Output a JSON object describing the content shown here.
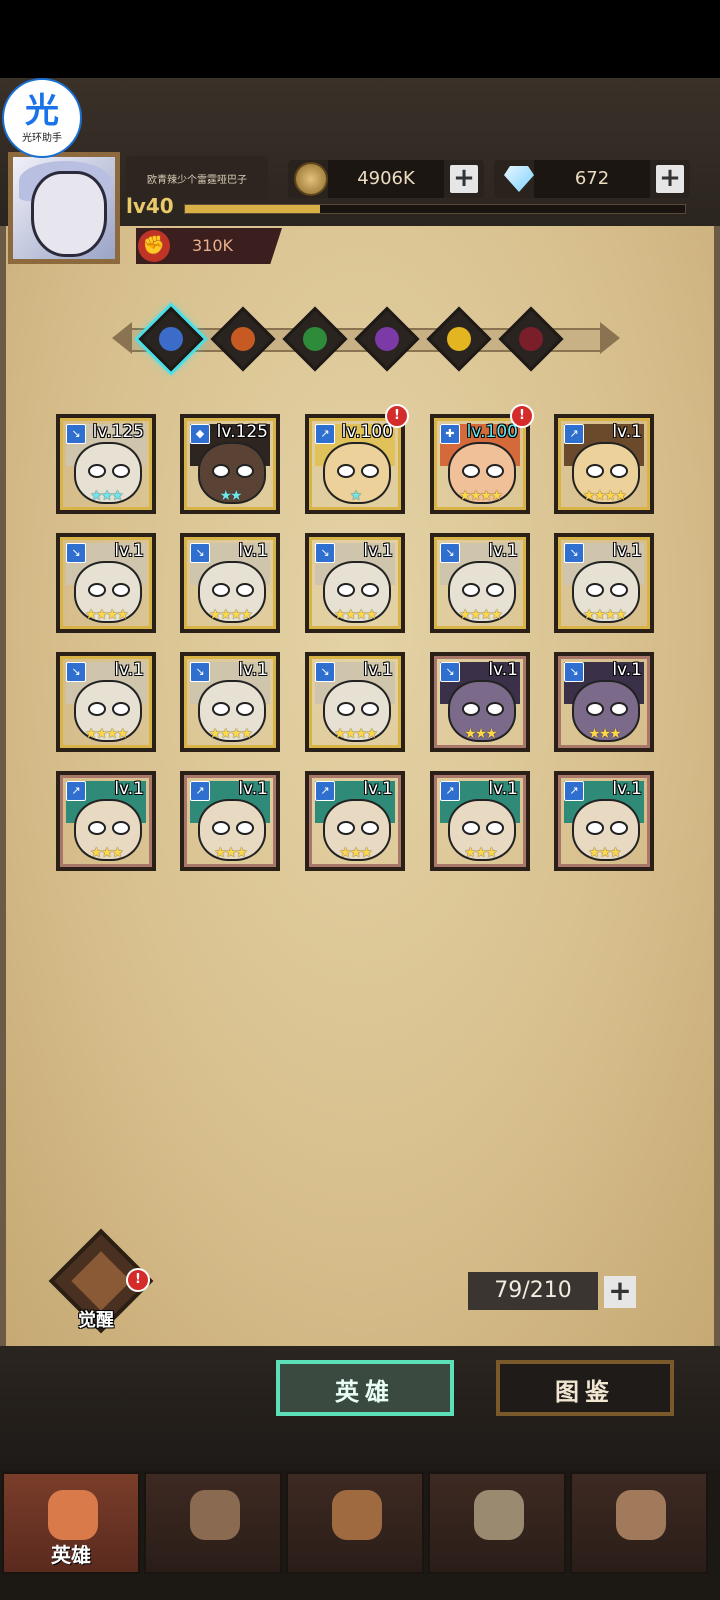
{
  "assistant_badge": {
    "glyph": "光",
    "label": "光环助手"
  },
  "player": {
    "name": "欧青辣少个雷霆哑巴子",
    "level": "lv40",
    "xp_fraction": 0.27,
    "power": "310K"
  },
  "resources": {
    "gold": "4906K",
    "gems": "672",
    "plus": "+"
  },
  "filters": [
    {
      "name": "all",
      "color": "#3b6cc9",
      "selected": true
    },
    {
      "name": "fire",
      "color": "#c75a22",
      "selected": false
    },
    {
      "name": "nature",
      "color": "#2e8b3a",
      "selected": false
    },
    {
      "name": "arcane",
      "color": "#7b3aa6",
      "selected": false
    },
    {
      "name": "light",
      "color": "#e3b521",
      "selected": false
    },
    {
      "name": "dark",
      "color": "#7a1e2a",
      "selected": false
    }
  ],
  "heroes": [
    {
      "lv": "lv.125",
      "stars": "★★★",
      "star_color": "#6ee6ea",
      "frame": "#d8b447",
      "skin": "#e6e1d2",
      "hair": "#cfc4ac",
      "cls": "↘",
      "alert": false,
      "lv_cyan": false
    },
    {
      "lv": "lv.125",
      "stars": "★★",
      "star_color": "#6ee6ea",
      "frame": "#d8b447",
      "skin": "#5a4334",
      "hair": "#2e2520",
      "cls": "◆",
      "alert": false,
      "lv_cyan": false
    },
    {
      "lv": "lv.100",
      "stars": "★",
      "star_color": "#6ee6ea",
      "frame": "#d8b447",
      "skin": "#ecd29a",
      "hair": "#e1c25a",
      "cls": "↗",
      "alert": true,
      "lv_cyan": false
    },
    {
      "lv": "lv.100",
      "stars": "★★★★",
      "star_color": "#ffd84a",
      "frame": "#d8b447",
      "skin": "#f0c098",
      "hair": "#d46a3a",
      "cls": "✚",
      "alert": true,
      "lv_cyan": true
    },
    {
      "lv": "lv.1",
      "stars": "★★★★",
      "star_color": "#ffd84a",
      "frame": "#d8b447",
      "skin": "#ecd29a",
      "hair": "#6a4a2a",
      "cls": "↗",
      "alert": false,
      "lv_cyan": false
    },
    {
      "lv": "lv.1",
      "stars": "★★★★",
      "star_color": "#ffd84a",
      "frame": "#d8b447",
      "skin": "#e6e1d2",
      "hair": "#cfc4ac",
      "cls": "↘",
      "alert": false,
      "lv_cyan": false
    },
    {
      "lv": "lv.1",
      "stars": "★★★★",
      "star_color": "#ffd84a",
      "frame": "#d8b447",
      "skin": "#e6e1d2",
      "hair": "#cfc4ac",
      "cls": "↘",
      "alert": false,
      "lv_cyan": false
    },
    {
      "lv": "lv.1",
      "stars": "★★★★",
      "star_color": "#ffd84a",
      "frame": "#d8b447",
      "skin": "#e6e1d2",
      "hair": "#cfc4ac",
      "cls": "↘",
      "alert": false,
      "lv_cyan": false
    },
    {
      "lv": "lv.1",
      "stars": "★★★★",
      "star_color": "#ffd84a",
      "frame": "#d8b447",
      "skin": "#e6e1d2",
      "hair": "#cfc4ac",
      "cls": "↘",
      "alert": false,
      "lv_cyan": false
    },
    {
      "lv": "lv.1",
      "stars": "★★★★",
      "star_color": "#ffd84a",
      "frame": "#d8b447",
      "skin": "#e6e1d2",
      "hair": "#cfc4ac",
      "cls": "↘",
      "alert": false,
      "lv_cyan": false
    },
    {
      "lv": "lv.1",
      "stars": "★★★★",
      "star_color": "#ffd84a",
      "frame": "#d8b447",
      "skin": "#e6e1d2",
      "hair": "#cfc4ac",
      "cls": "↘",
      "alert": false,
      "lv_cyan": false
    },
    {
      "lv": "lv.1",
      "stars": "★★★★",
      "star_color": "#ffd84a",
      "frame": "#d8b447",
      "skin": "#e6e1d2",
      "hair": "#cfc4ac",
      "cls": "↘",
      "alert": false,
      "lv_cyan": false
    },
    {
      "lv": "lv.1",
      "stars": "★★★★",
      "star_color": "#ffd84a",
      "frame": "#d8b447",
      "skin": "#e6e1d2",
      "hair": "#cfc4ac",
      "cls": "↘",
      "alert": false,
      "lv_cyan": false
    },
    {
      "lv": "lv.1",
      "stars": "★★★",
      "star_color": "#ffd84a",
      "frame": "#a9776a",
      "skin": "#7b6a8a",
      "hair": "#3a3048",
      "cls": "↘",
      "alert": false,
      "lv_cyan": false
    },
    {
      "lv": "lv.1",
      "stars": "★★★",
      "star_color": "#ffd84a",
      "frame": "#a9776a",
      "skin": "#7b6a8a",
      "hair": "#3a3048",
      "cls": "↘",
      "alert": false,
      "lv_cyan": false
    },
    {
      "lv": "lv.1",
      "stars": "★★★",
      "star_color": "#ffd84a",
      "frame": "#a9776a",
      "skin": "#e8d9c2",
      "hair": "#2f8a78",
      "cls": "↗",
      "alert": false,
      "lv_cyan": false
    },
    {
      "lv": "lv.1",
      "stars": "★★★",
      "star_color": "#ffd84a",
      "frame": "#a9776a",
      "skin": "#e8d9c2",
      "hair": "#2f8a78",
      "cls": "↗",
      "alert": false,
      "lv_cyan": false
    },
    {
      "lv": "lv.1",
      "stars": "★★★",
      "star_color": "#ffd84a",
      "frame": "#a9776a",
      "skin": "#e8d9c2",
      "hair": "#2f8a78",
      "cls": "↗",
      "alert": false,
      "lv_cyan": false
    },
    {
      "lv": "lv.1",
      "stars": "★★★",
      "star_color": "#ffd84a",
      "frame": "#a9776a",
      "skin": "#e8d9c2",
      "hair": "#2f8a78",
      "cls": "↗",
      "alert": false,
      "lv_cyan": false
    },
    {
      "lv": "lv.1",
      "stars": "★★★",
      "star_color": "#ffd84a",
      "frame": "#a9776a",
      "skin": "#e8d9c2",
      "hair": "#2f8a78",
      "cls": "↗",
      "alert": false,
      "lv_cyan": false
    }
  ],
  "awaken": {
    "label": "觉醒",
    "alert": "!"
  },
  "roster": {
    "count": "79/210",
    "plus": "+"
  },
  "tabs": {
    "heroes": "英雄",
    "codex": "图鉴"
  },
  "nav": [
    {
      "label": "英雄",
      "icon": "helmet-icon",
      "active": true
    },
    {
      "label": "",
      "icon": "flag-icon",
      "active": false
    },
    {
      "label": "",
      "icon": "crossed-swords-icon",
      "active": false
    },
    {
      "label": "",
      "icon": "castle-icon",
      "active": false
    },
    {
      "label": "",
      "icon": "guild-emblem-icon",
      "active": false
    }
  ]
}
